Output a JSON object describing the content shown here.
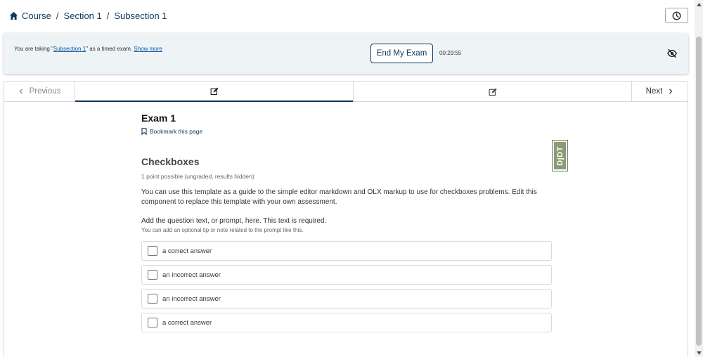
{
  "breadcrumb": {
    "items": [
      "Course",
      "Section 1",
      "Subsection 1"
    ],
    "separator": "/"
  },
  "banner": {
    "text_prefix": "You are taking \"",
    "subsection_link": "Subsection 1",
    "text_suffix": "\" as a timed exam. ",
    "show_more": "Show more",
    "end_button": "End My Exam",
    "timer": "00:29:55"
  },
  "sequence": {
    "previous_label": "Previous",
    "next_label": "Next",
    "units": [
      {
        "icon": "edit-icon",
        "active": true
      },
      {
        "icon": "edit-icon",
        "active": false
      }
    ]
  },
  "unit": {
    "title": "Exam 1",
    "bookmark_label": "Bookmark this page"
  },
  "problem": {
    "title": "Checkboxes",
    "points": "1 point possible (ungraded, results hidden)",
    "description": "You can use this template as a guide to the simple editor markdown and OLX markup to use for checkboxes problems. Edit this component to replace this template with your own assessment.",
    "prompt": "Add the question text, or prompt, here. This text is required.",
    "tip": "You can add an optional tip or note related to the prompt like this.",
    "choices": [
      "a correct answer",
      "an incorrect answer",
      "an incorrect answer",
      "a correct answer"
    ]
  },
  "debug_toolbar": {
    "label": "DjDT"
  },
  "colors": {
    "primary": "#10375c",
    "link": "#0a5aa5",
    "banner_bg": "#eef3f6",
    "border": "#d5dadf",
    "djdt_green": "#8a9c70"
  }
}
